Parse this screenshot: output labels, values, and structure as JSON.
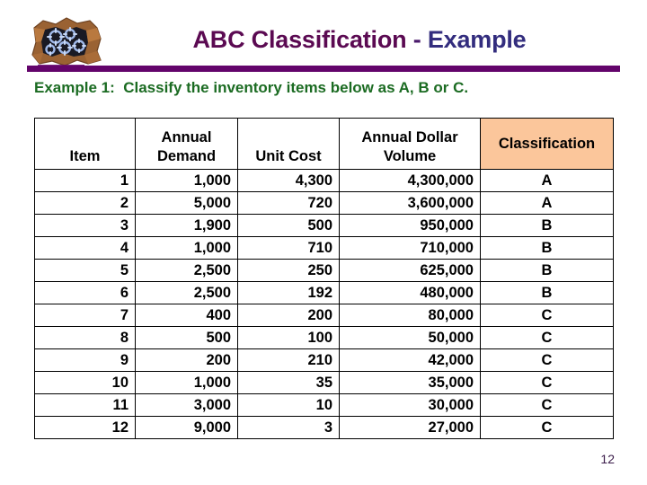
{
  "slide": {
    "title_part1": "ABC Classification",
    "title_part2": " - ",
    "title_part3": "Example",
    "subtitle": "Example 1:  Classify the inventory items below as A, B or C.",
    "page_number": "12",
    "logo_alt": "broken-box-gears-logo"
  },
  "colors": {
    "title_purple": "#5B0A52",
    "title_blue": "#332D7E",
    "rule_purple": "#63046B",
    "subtitle_green": "#1B6B22",
    "header_peach": "#FBC69B",
    "class_a": "#FFFF00",
    "class_b": "#00FFFF",
    "class_c": "#00E500",
    "page_number": "#3B1C4A"
  },
  "table": {
    "headers": [
      {
        "lines": [
          "Item"
        ]
      },
      {
        "lines": [
          "Annual",
          "Demand"
        ]
      },
      {
        "lines": [
          "Unit Cost"
        ]
      },
      {
        "lines": [
          "Annual Dollar",
          "Volume"
        ]
      },
      {
        "lines": [
          "Classification"
        ]
      }
    ],
    "rows": [
      {
        "item": "1",
        "demand": "1,000",
        "cost": "4,300",
        "volume": "4,300,000",
        "classification": "A"
      },
      {
        "item": "2",
        "demand": "5,000",
        "cost": "720",
        "volume": "3,600,000",
        "classification": "A"
      },
      {
        "item": "3",
        "demand": "1,900",
        "cost": "500",
        "volume": "950,000",
        "classification": "B"
      },
      {
        "item": "4",
        "demand": "1,000",
        "cost": "710",
        "volume": "710,000",
        "classification": "B"
      },
      {
        "item": "5",
        "demand": "2,500",
        "cost": "250",
        "volume": "625,000",
        "classification": "B"
      },
      {
        "item": "6",
        "demand": "2,500",
        "cost": "192",
        "volume": "480,000",
        "classification": "B"
      },
      {
        "item": "7",
        "demand": "400",
        "cost": "200",
        "volume": "80,000",
        "classification": "C"
      },
      {
        "item": "8",
        "demand": "500",
        "cost": "100",
        "volume": "50,000",
        "classification": "C"
      },
      {
        "item": "9",
        "demand": "200",
        "cost": "210",
        "volume": "42,000",
        "classification": "C"
      },
      {
        "item": "10",
        "demand": "1,000",
        "cost": "35",
        "volume": "35,000",
        "classification": "C"
      },
      {
        "item": "11",
        "demand": "3,000",
        "cost": "10",
        "volume": "30,000",
        "classification": "C"
      },
      {
        "item": "12",
        "demand": "9,000",
        "cost": "3",
        "volume": "27,000",
        "classification": "C"
      }
    ]
  }
}
